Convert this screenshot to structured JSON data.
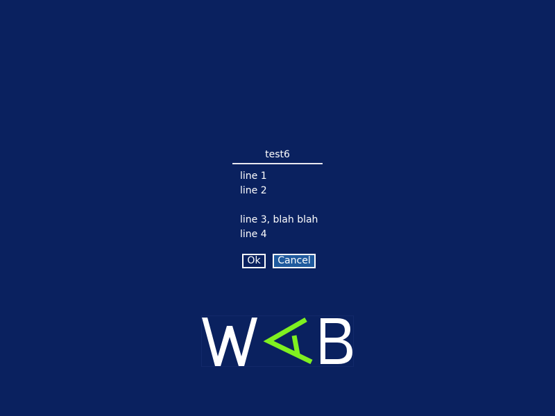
{
  "dialog": {
    "title": "test6",
    "lines": [
      "line 1",
      "line 2",
      "",
      "line 3, blah blah",
      "line 4"
    ],
    "buttons": {
      "ok_label": "Ok",
      "cancel_label": "Cancel"
    }
  },
  "logo": {
    "text": "WAB",
    "colors": {
      "letters": "#ffffff",
      "accent": "#7ff020"
    }
  },
  "colors": {
    "background": "#0a215f",
    "focused_button": "#1f5a9e",
    "text": "#ffffff"
  }
}
